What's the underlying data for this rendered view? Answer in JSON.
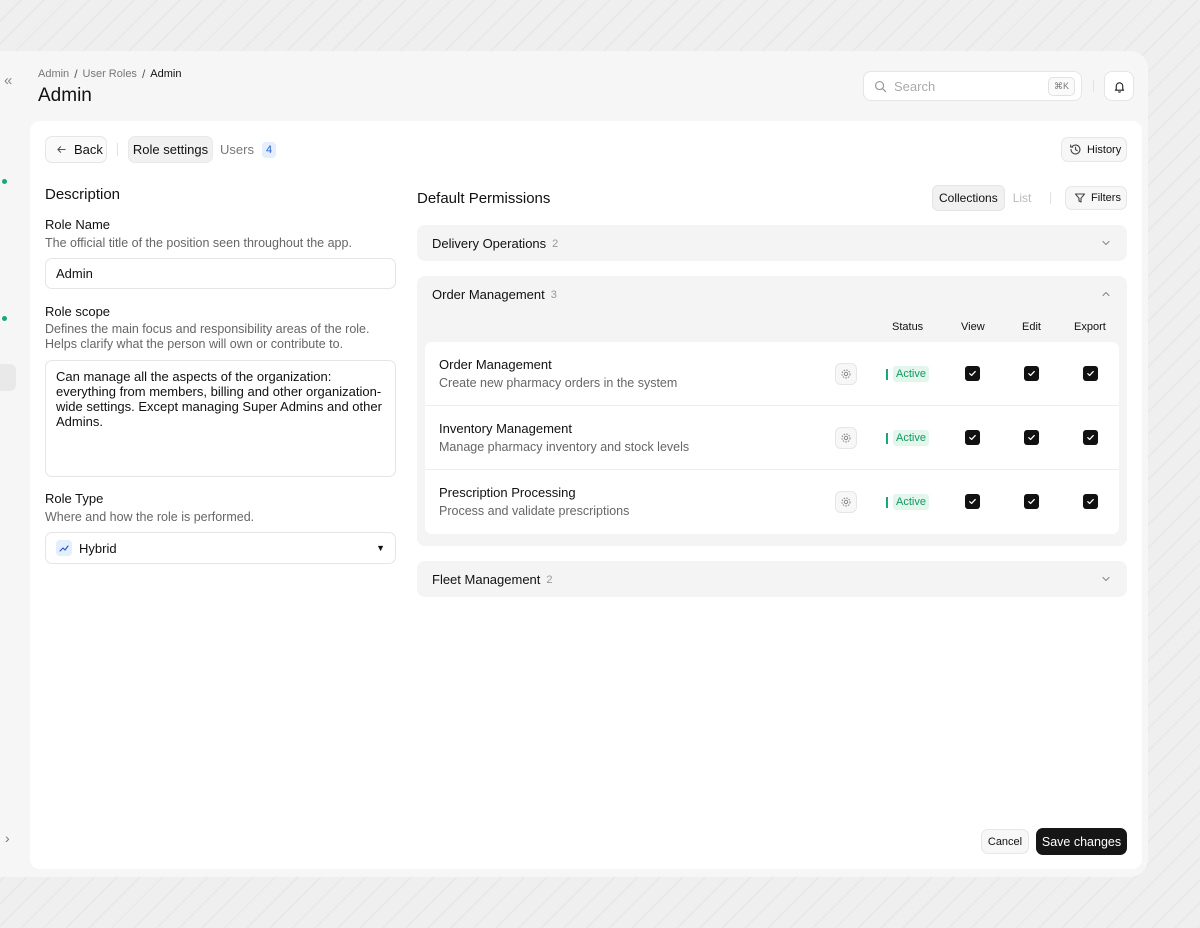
{
  "breadcrumb": [
    "Admin",
    "User Roles",
    "Admin"
  ],
  "page": {
    "title": "Admin"
  },
  "search": {
    "placeholder": "Search",
    "shortcut": "⌘K"
  },
  "toolbar": {
    "back_label": "Back",
    "tab_role_settings": "Role settings",
    "tab_users": "Users",
    "users_count": "4",
    "history_label": "History"
  },
  "description": {
    "heading": "Description",
    "role_name": {
      "label": "Role Name",
      "help": "The official title of the position seen throughout the app.",
      "value": "Admin"
    },
    "role_scope": {
      "label": "Role scope",
      "help": "Defines the main focus and responsibility areas of the role. Helps clarify what the person will own or contribute to.",
      "value": "Can manage all the aspects of the organization: everything from members, billing and other organization-wide settings. Except managing Super Admins and other Admins."
    },
    "role_type": {
      "label": "Role Type",
      "help": "Where and how the role is performed.",
      "value": "Hybrid"
    }
  },
  "permissions": {
    "heading": "Default Permissions",
    "view_toggle": {
      "collections": "Collections",
      "list": "List"
    },
    "filters_label": "Filters",
    "columns": {
      "status": "Status",
      "view": "View",
      "edit": "Edit",
      "export": "Export"
    },
    "groups": [
      {
        "name": "Delivery Operations",
        "count": "2",
        "expanded": false
      },
      {
        "name": "Order Management",
        "count": "3",
        "expanded": true,
        "rows": [
          {
            "title": "Order Management",
            "desc": "Create new pharmacy orders in the system",
            "status": "Active",
            "view": true,
            "edit": true,
            "export": true
          },
          {
            "title": "Inventory Management",
            "desc": "Manage pharmacy inventory and stock levels",
            "status": "Active",
            "view": true,
            "edit": true,
            "export": true
          },
          {
            "title": "Prescription Processing",
            "desc": "Process and validate prescriptions",
            "status": "Active",
            "view": true,
            "edit": true,
            "export": true
          }
        ]
      },
      {
        "name": "Fleet Management",
        "count": "2",
        "expanded": false
      }
    ]
  },
  "footer": {
    "cancel_label": "Cancel",
    "save_label": "Save changes"
  },
  "colors": {
    "accent_green": "#19a974",
    "primary_dark": "#161616",
    "badge_blue": "#2461c8"
  }
}
